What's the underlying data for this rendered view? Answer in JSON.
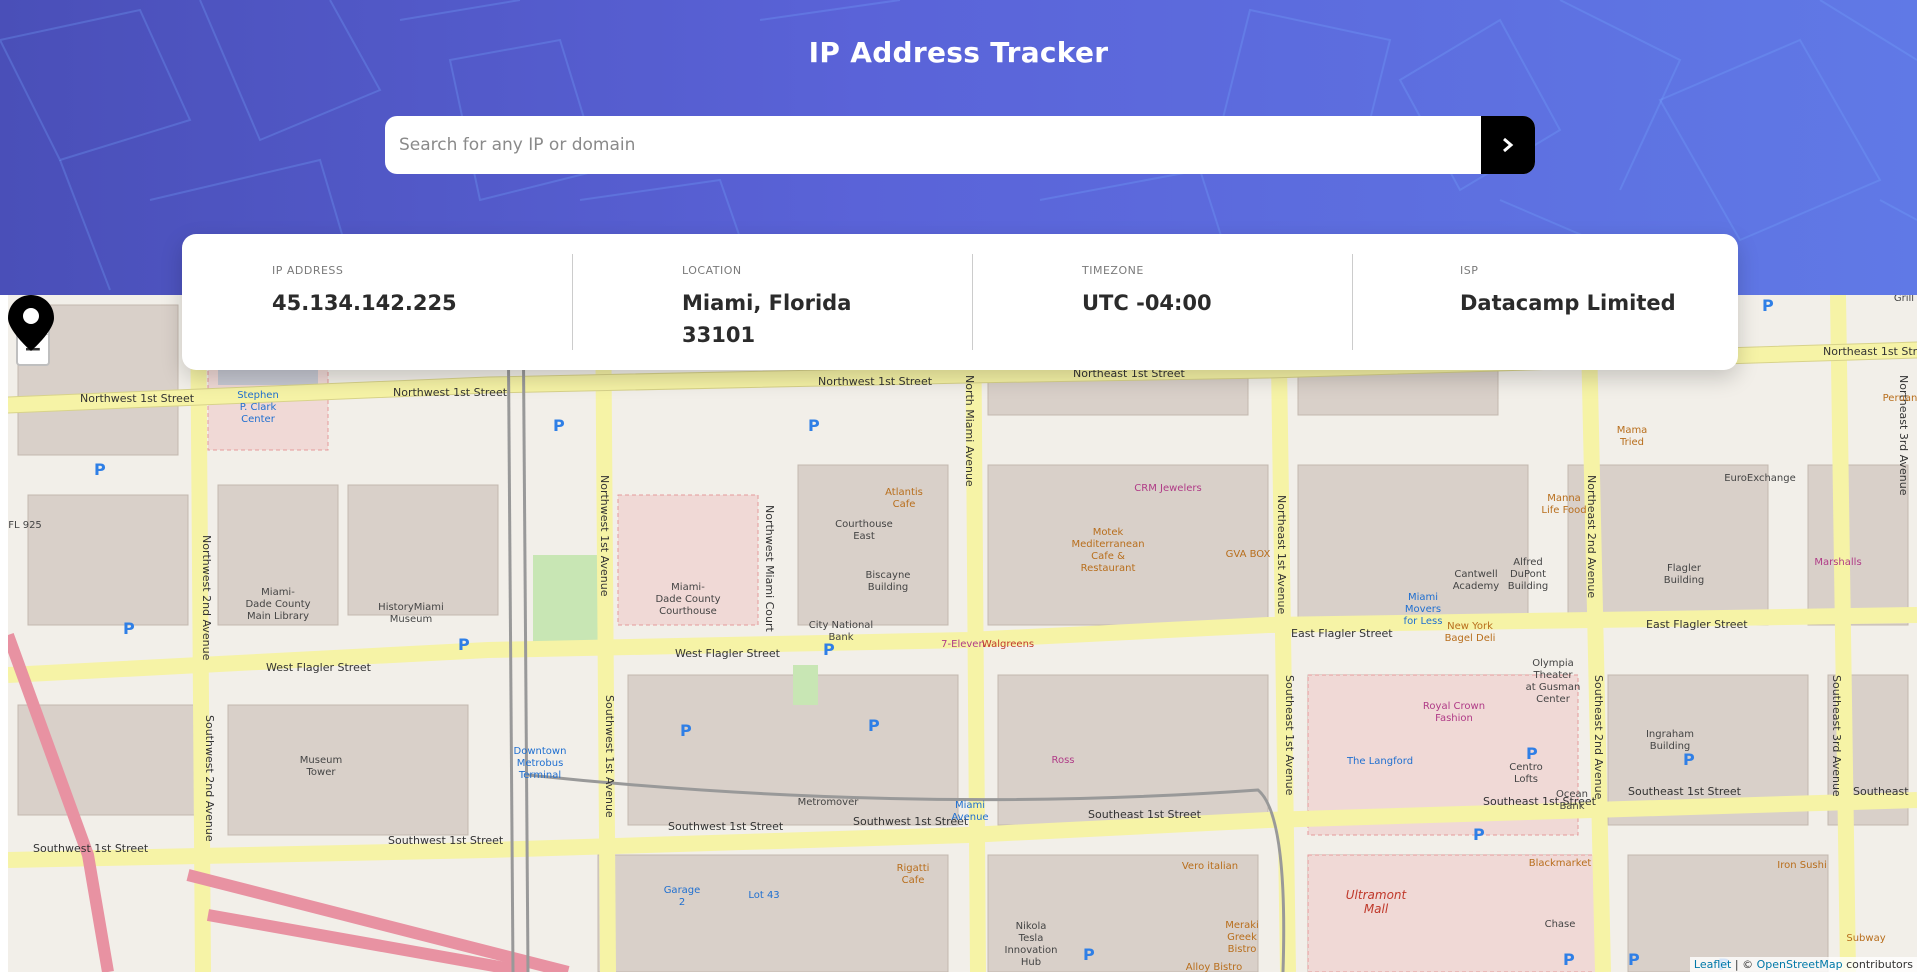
{
  "app": {
    "title": "IP Address Tracker"
  },
  "search": {
    "placeholder": "Search for any IP or domain",
    "value": "",
    "button_icon": "chevron-right-icon"
  },
  "info": {
    "ip_label": "IP ADDRESS",
    "ip_value": "45.134.142.225",
    "location_label": "LOCATION",
    "location_value_line1": "Miami, Florida",
    "location_value_line2": "33101",
    "timezone_label": "TIMEZONE",
    "timezone_value": "UTC -04:00",
    "isp_label": "ISP",
    "isp_value": "Datacamp Limited"
  },
  "map": {
    "zoom_in": "+",
    "zoom_out": "−",
    "attribution_leaflet": "Leaflet",
    "attribution_sep": " | © ",
    "attribution_osm": "OpenStreetMap",
    "attribution_tail": " contributors",
    "streets": [
      "Northwest 1st Street",
      "Northwest 1st Street",
      "Northwest 1st Street",
      "Northeast 1st Street",
      "Northeast 1st Street",
      "Northeast 1st Street",
      "West Flagler Street",
      "West Flagler Street",
      "East Flagler Street",
      "East Flagler Street",
      "Southwest 1st Street",
      "Southwest 1st Street",
      "Southwest 1st Street",
      "Southeast 1st Street",
      "Southeast 1st Street",
      "Southeast 1st Street",
      "North Miami Avenue",
      "Northwest 1st Avenue",
      "Northwest Miami Court",
      "Northwest 2nd Avenue",
      "Southwest 2nd Avenue",
      "Southwest 1st Avenue",
      "Northeast 1st Avenue",
      "Southeast 1st Avenue",
      "Northeast 2nd Avenue",
      "Southeast 2nd Avenue",
      "Southeast 3rd Avenue",
      "Northeast 3rd Avenue"
    ],
    "places": [
      "Stephen P. Clark Center",
      "Miami-Dade County Main Library",
      "HistoryMiami Museum",
      "Miami-Dade County Courthouse",
      "Courthouse East",
      "Atlantis Cafe",
      "Biscayne Building",
      "City National Bank",
      "7-Eleven",
      "Walgreens",
      "Motek Mediterranean Cafe & Restaurant",
      "CRM Jewelers",
      "GVA BOX",
      "Miami Movers for Less",
      "Cantwell Academy",
      "Alfred DuPont Building",
      "Manna Life Food",
      "New York Bagel Deli",
      "Flagler Building",
      "Marshalls",
      "EuroExchange",
      "Mama Tried",
      "Peruan",
      "Olympia Theater at Gusman Center",
      "Royal Crown Fashion",
      "The Langford",
      "Centro Lofts",
      "Ocean Bank",
      "Ingraham Building",
      "Ross",
      "Museum Tower",
      "Downtown Metrobus Terminal",
      "Metromover",
      "Miami Avenue",
      "Rigatti Cafe",
      "Garage 2",
      "Lot 43",
      "Nikola Tesla Innovation Hub",
      "Vero italian",
      "Meraki Greek Bistro",
      "Alloy Bistro",
      "Ultramont Mall",
      "Blackmarket",
      "Chase",
      "Iron Sushi",
      "Subway",
      "FL 925",
      "Grill"
    ]
  }
}
